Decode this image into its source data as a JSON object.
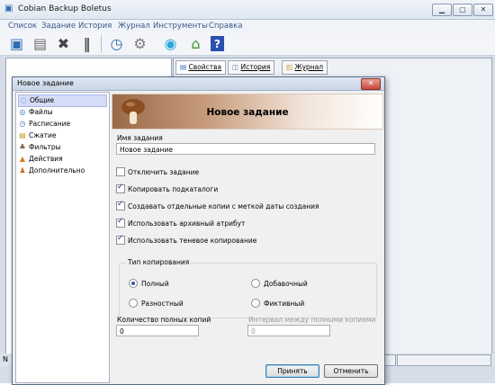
{
  "app": {
    "title": "Cobian Backup Boletus",
    "menu": [
      "Список",
      "Задание",
      "История",
      "Журнал",
      "Инструменты",
      "Справка"
    ],
    "toolbar_icons": [
      "save-all-icon",
      "save-icon",
      "delete-icon",
      "pause-icon",
      "clock-icon",
      "settings-icon",
      "wifi-icon",
      "home-icon",
      "help-icon"
    ],
    "tabs": [
      "Свойства",
      "История",
      "Журнал"
    ],
    "status_char": "N"
  },
  "dialog": {
    "title": "Новое задание",
    "close_label": "✕",
    "sidebar": {
      "items": [
        {
          "label": "Общие",
          "icon": "general-icon",
          "selected": true
        },
        {
          "label": "Файлы",
          "icon": "files-icon"
        },
        {
          "label": "Расписание",
          "icon": "schedule-icon"
        },
        {
          "label": "Сжатие",
          "icon": "compression-icon"
        },
        {
          "label": "Фильтры",
          "icon": "filters-icon"
        },
        {
          "label": "Действия",
          "icon": "actions-icon"
        },
        {
          "label": "Дополнительно",
          "icon": "advanced-icon"
        }
      ]
    },
    "banner_title": "Новое задание",
    "task_name_label": "Имя задания",
    "task_name_value": "Новое задание",
    "checkboxes": [
      {
        "label": "Отключить задание",
        "checked": false
      },
      {
        "label": "Копировать подкаталоги",
        "checked": true
      },
      {
        "label": "Создавать отдельные копии с меткой даты создания",
        "checked": true
      },
      {
        "label": "Использовать архивный атрибут",
        "checked": true
      },
      {
        "label": "Использовать теневое копирование",
        "checked": true
      }
    ],
    "copy_type": {
      "legend": "Тип копирования",
      "options": [
        {
          "label": "Полный",
          "selected": true
        },
        {
          "label": "Добавочный",
          "selected": false
        },
        {
          "label": "Разностный",
          "selected": false
        },
        {
          "label": "Фиктивный",
          "selected": false
        }
      ]
    },
    "full_copies_label": "Количество полных копий",
    "full_copies_value": "0",
    "interval_label": "Интервал между полными копиями",
    "interval_value": "0",
    "ok_label": "Принять",
    "cancel_label": "Отменить"
  },
  "colors": {
    "accent": "#3c7fb1",
    "selected_bg": "#d5dcf7",
    "close_red": "#c6463a"
  }
}
